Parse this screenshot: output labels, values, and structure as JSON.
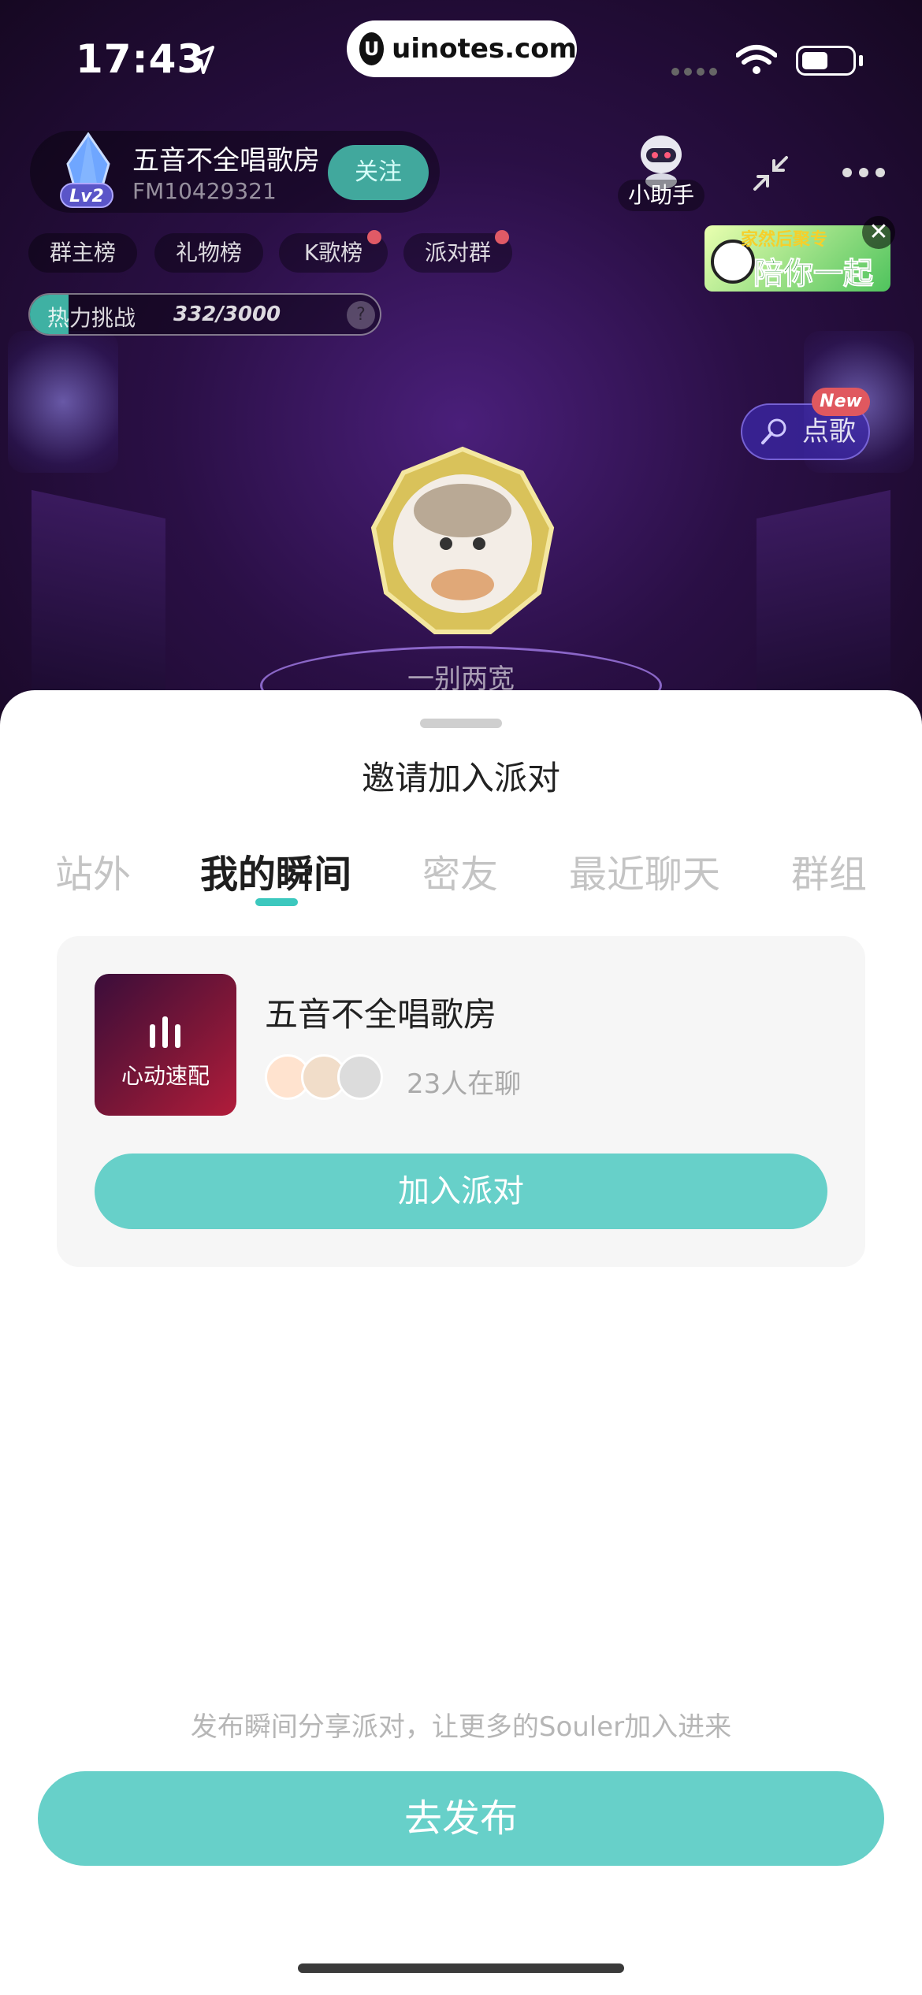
{
  "status_bar": {
    "time": "17:43",
    "url": "uinotes.com",
    "url_logo": "U",
    "icons": [
      "location-arrow-icon",
      "signal-dots-icon",
      "wifi-icon",
      "battery-icon"
    ]
  },
  "room": {
    "name": "五音不全唱歌房",
    "id": "FM10429321",
    "level": "Lv2",
    "follow_label": "关注",
    "assistant_label": "小助手",
    "tags": [
      "群主榜",
      "礼物榜",
      "K歌榜",
      "派对群"
    ],
    "heat": {
      "label": "热力挑战",
      "value": "332/3000",
      "progress": 0.11,
      "help": "?"
    },
    "banner": {
      "top_text": "家然后聚专",
      "text": "陪你一起",
      "close": "✕"
    },
    "song": {
      "label": "点歌",
      "badge": "New"
    },
    "stage_name": "一别两宽"
  },
  "sheet": {
    "title": "邀请加入派对",
    "tabs": [
      "站外",
      "我的瞬间",
      "密友",
      "最近聊天",
      "群组"
    ],
    "active_tab_index": 1,
    "party": {
      "thumb_label": "心动速配",
      "name": "五音不全唱歌房",
      "online": "23人在聊",
      "join_label": "加入派对"
    },
    "hint": "发布瞬间分享派对，让更多的Souler加入进来",
    "publish_label": "去发布"
  },
  "colors": {
    "accent": "#67d0c9",
    "tab_indicator": "#3cc8be",
    "follow_bg": "#41a89d",
    "new_badge": "#e0585f"
  }
}
